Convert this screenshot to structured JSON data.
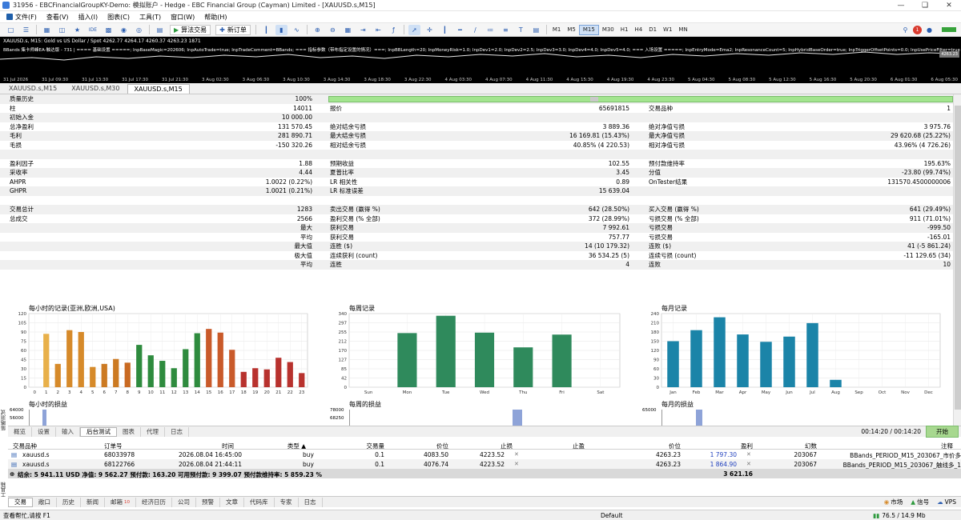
{
  "window": {
    "title": "31956 - EBCFinancialGroupKY-Demo: 模拟账户 - Hedge - EBC Financial Group (Cayman) Limited - [XAUUSD.s,M15]"
  },
  "menu": [
    "文件(F)",
    "查看(V)",
    "插入(I)",
    "图表(C)",
    "工具(T)",
    "窗口(W)",
    "帮助(H)"
  ],
  "toolbar": {
    "algo_trading": "算法交易",
    "new_order": "新订单",
    "timeframes": [
      "M1",
      "M5",
      "M15",
      "M30",
      "H1",
      "H4",
      "D1",
      "W1",
      "MN"
    ],
    "active_timeframe": "M15",
    "notif_count": "1"
  },
  "chart": {
    "header": "XAUUSD.s, M15: Gold vs US Dollar / Spot  4262.77 4264.17 4260.37 4263.23  1871",
    "params": "BBands 集卡师峰EA-触达版 - 731 | ==== 基础设置 =====; InpBaseMagic=202606; InpAutoTrade=true; InpTradeComment=BBands; === 指标参数（带布指定设置的情况）===; InpBBLength=20; InpMoneyRisk=1.0; InpDev1=2.0; InpDev2=2.5; InpDev3=3.0; InpDev4=4.0; InpDev5=4.0; === 入场设置 =====; InpEntryMode=Ema2; InpResonanceCount=5; InpHybridBaseOrder=true; InpTriggerOffsetPoints=0.0; InpUsePriceFilter=true",
    "price_tag": "4263.23",
    "dates": [
      "31 Jul 2026",
      "31 Jul 09:30",
      "31 Jul 13:30",
      "31 Jul 17:30",
      "31 Jul 21:30",
      "3 Aug 02:30",
      "3 Aug 06:30",
      "3 Aug 10:30",
      "3 Aug 14:30",
      "3 Aug 18:30",
      "3 Aug 22:30",
      "4 Aug 03:30",
      "4 Aug 07:30",
      "4 Aug 11:30",
      "4 Aug 15:30",
      "4 Aug 19:30",
      "4 Aug 23:30",
      "5 Aug 04:30",
      "5 Aug 08:30",
      "5 Aug 12:30",
      "5 Aug 16:30",
      "5 Aug 20:30",
      "6 Aug 01:30",
      "6 Aug 05:30"
    ]
  },
  "chart_tabs": [
    "XAUUSD.s,M15",
    "XAUUSD.s,M30",
    "XAUUSD.s,M15"
  ],
  "report": {
    "history_quality_label": "质量历史",
    "history_quality_value": "100%",
    "rows": [
      {
        "l1": "柱",
        "v1": "14011",
        "l2": "报价",
        "v2": "65691815",
        "l3": "交易品种",
        "v3": "1"
      },
      {
        "l1": "初始入金",
        "v1": "10 000.00",
        "l2": "",
        "v2": "",
        "l3": "",
        "v3": ""
      },
      {
        "l1": "总净盈利",
        "v1": "131 570.45",
        "l2": "绝对结余亏损",
        "v2": "3 889.36",
        "l3": "绝对净值亏损",
        "v3": "3 975.76"
      },
      {
        "l1": "毛利",
        "v1": "281 890.71",
        "l2": "最大结余亏损",
        "v2": "16 169.81 (15.43%)",
        "l3": "最大净值亏损",
        "v3": "29 620.68 (25.22%)"
      },
      {
        "l1": "毛损",
        "v1": "-150 320.26",
        "l2": "相对结余亏损",
        "v2": "40.85% (4 220.53)",
        "l3": "相对净值亏损",
        "v3": "43.96% (4 726.26)"
      },
      {
        "l1": "",
        "v1": "",
        "l2": "",
        "v2": "",
        "l3": "",
        "v3": ""
      },
      {
        "l1": "盈利因子",
        "v1": "1.88",
        "l2": "预期收益",
        "v2": "102.55",
        "l3": "预付款维持率",
        "v3": "195.63%"
      },
      {
        "l1": "采收率",
        "v1": "4.44",
        "l2": "夏普比率",
        "v2": "3.45",
        "l3": "分值",
        "v3": "-23.80 (99.74%)"
      },
      {
        "l1": "AHPR",
        "v1": "1.0022 (0.22%)",
        "l2": "LR 相关性",
        "v2": "0.89",
        "l3": "OnTester结果",
        "v3": "131570.4500000006"
      },
      {
        "l1": "GHPR",
        "v1": "1.0021 (0.21%)",
        "l2": "LR 标准误差",
        "v2": "15 639.04",
        "l3": "",
        "v3": ""
      },
      {
        "l1": "",
        "v1": "",
        "l2": "",
        "v2": "",
        "l3": "",
        "v3": ""
      },
      {
        "l1": "交易总计",
        "v1": "1283",
        "l2": "卖出交易 (赢得 %)",
        "v2": "642 (28.50%)",
        "l3": "买入交易 (赢得 %)",
        "v3": "641 (29.49%)"
      },
      {
        "l1": "总成交",
        "v1": "2566",
        "l2": "盈利交易 (% 全部)",
        "v2": "372 (28.99%)",
        "l3": "亏损交易 (% 全部)",
        "v3": "911 (71.01%)"
      },
      {
        "l1": "",
        "v1": "最大",
        "l2": "获利交易",
        "v2": "7 992.61",
        "l3": "亏损交易",
        "v3": "-999.50"
      },
      {
        "l1": "",
        "v1": "平均",
        "l2": "获利交易",
        "v2": "757.77",
        "l3": "亏损交易",
        "v3": "-165.01"
      },
      {
        "l1": "",
        "v1": "最大值",
        "l2": "连胜 ($)",
        "v2": "14 (10 179.32)",
        "l3": "连败 ($)",
        "v3": "41 (-5 861.24)"
      },
      {
        "l1": "",
        "v1": "极大值",
        "l2": "连续获利 (count)",
        "v2": "36 534.25 (5)",
        "l3": "连续亏损 (count)",
        "v3": "-11 129.65 (34)"
      },
      {
        "l1": "",
        "v1": "平均",
        "l2": "连胜",
        "v2": "4",
        "l3": "连败",
        "v3": "10"
      }
    ]
  },
  "chart_data": [
    {
      "type": "bar",
      "title": "每小时的记录(亚洲,欧洲,USA)",
      "categories": [
        "0",
        "1",
        "2",
        "3",
        "4",
        "5",
        "6",
        "7",
        "8",
        "9",
        "10",
        "11",
        "12",
        "13",
        "14",
        "15",
        "16",
        "17",
        "18",
        "19",
        "20",
        "21",
        "22",
        "23"
      ],
      "values": [
        0,
        87,
        38,
        93,
        90,
        33,
        38,
        46,
        40,
        69,
        52,
        43,
        31,
        62,
        88,
        95,
        89,
        61,
        25,
        31,
        29,
        48,
        41,
        23
      ],
      "colors": [
        "#e8b04a",
        "#e8b04a",
        "#d68a2a",
        "#d68a2a",
        "#d68a2a",
        "#d68a2a",
        "#cc7a22",
        "#cc7a22",
        "#c96a22",
        "#2e8b3e",
        "#2e8b3e",
        "#2e8b3e",
        "#2e8b3e",
        "#2e8b3e",
        "#2e8b3e",
        "#c95a2a",
        "#c95a2a",
        "#c95a2a",
        "#b8322e",
        "#b8322e",
        "#b8322e",
        "#b8322e",
        "#b8322e",
        "#b8322e"
      ],
      "ylim": [
        0,
        120
      ],
      "yticks": [
        0,
        15,
        30,
        45,
        60,
        75,
        90,
        105,
        120
      ]
    },
    {
      "type": "bar",
      "title": "每周记录",
      "categories": [
        "Sun",
        "Mon",
        "Tue",
        "Wed",
        "Thu",
        "Fri",
        "Sat"
      ],
      "values": [
        0,
        250,
        330,
        252,
        184,
        243,
        0
      ],
      "color": "#2f8a5c",
      "ylim": [
        0,
        340
      ],
      "yticks": [
        0,
        42,
        85,
        127,
        170,
        212,
        255,
        297,
        340
      ]
    },
    {
      "type": "bar",
      "title": "每月记录",
      "categories": [
        "Jan",
        "Feb",
        "Mar",
        "Apr",
        "May",
        "Jun",
        "Jul",
        "Aug",
        "Sep",
        "Oct",
        "Nov",
        "Dec"
      ],
      "values": [
        150,
        186,
        228,
        172,
        148,
        165,
        209,
        24,
        0,
        0,
        0,
        0
      ],
      "color": "#1b84a8",
      "ylim": [
        0,
        240
      ],
      "yticks": [
        0,
        30,
        60,
        90,
        120,
        150,
        180,
        210,
        240
      ]
    }
  ],
  "pnl_charts": {
    "hourly_title": "每小时的损益",
    "hourly_ticks": [
      "64000",
      "56000"
    ],
    "weekly_title": "每周的损益",
    "weekly_ticks": [
      "78000",
      "68250"
    ],
    "monthly_title": "每月的损益",
    "monthly_ticks": [
      "65000"
    ]
  },
  "tester_tabs": [
    "概览",
    "设置",
    "输入",
    "后台测试",
    "图表",
    "代理",
    "日志"
  ],
  "tester_active": "后台测试",
  "tester": {
    "timer": "00:14:20 / 00:14:20",
    "start": "开始",
    "side_label": "策略测试"
  },
  "trades": {
    "headers": {
      "symbol": "交易品种",
      "ticket": "订单号",
      "time": "时间",
      "type": "类型",
      "volume": "交易量",
      "price": "价位",
      "sl": "止损",
      "tp": "止盈",
      "price2": "价位",
      "profit": "盈利",
      "magic": "幻数",
      "comment": "注释"
    },
    "rows": [
      {
        "symbol": "xauusd.s",
        "ticket": "68033978",
        "time": "2026.08.04 16:45:00",
        "type": "buy",
        "volume": "0.1",
        "price": "4083.50",
        "sl": "4223.52",
        "tp": "",
        "price2": "4263.23",
        "profit": "1 797.30",
        "magic": "203067",
        "comment": "BBands_PERIOD_M15_203067_市价多"
      },
      {
        "symbol": "xauusd.s",
        "ticket": "68122766",
        "time": "2026.08.04 21:44:11",
        "type": "buy",
        "volume": "0.1",
        "price": "4076.74",
        "sl": "4223.52",
        "tp": "",
        "price2": "4263.23",
        "profit": "1 864.90",
        "magic": "203067",
        "comment": "BBands_PERIOD_M15_203067_触线多_1"
      }
    ],
    "summary": "结余: 5 941.11 USD  净值: 9 562.27  预付款: 163.20  可用预付款: 9 399.07  预付款维持率: 5 859.23 %",
    "summary_profit": "3 621.16"
  },
  "toolbox_tabs": [
    "交易",
    "敞口",
    "历史",
    "新闻",
    "邮箱",
    "经济日历",
    "公司",
    "预警",
    "文章",
    "代码库",
    "专家",
    "日志"
  ],
  "toolbox_active": "交易",
  "mail_badge": "10",
  "toolbox_side_label": "工具箱",
  "toolbox_right": {
    "market": "市场",
    "signals": "信号",
    "vps": "VPS"
  },
  "status": {
    "help": "查看帮忙,请按 F1",
    "profile": "Default",
    "net": "76.5 / 14.9 Mb"
  }
}
